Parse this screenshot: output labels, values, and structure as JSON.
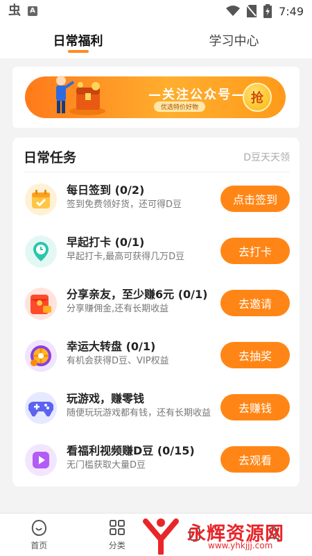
{
  "status_bar": {
    "time": "7:49",
    "app_icon": "bug-app-icon",
    "a_icon": "A"
  },
  "tabs": [
    {
      "label": "日常福利",
      "active": true
    },
    {
      "label": "学习中心",
      "active": false
    }
  ],
  "banner": {
    "title": "—关注公众号—",
    "subtitle": "优选特价好物",
    "grab_label": "抢"
  },
  "tasks_card": {
    "title": "日常任务",
    "hint": "D豆天天领",
    "tasks": [
      {
        "name": "每日签到 (0/2)",
        "desc": "签到免费领好货，还可得D豆",
        "button": "点击签到",
        "icon": "calendar-icon"
      },
      {
        "name": "早起打卡 (0/1)",
        "desc": "早起打卡,最高可获得几万D豆",
        "button": "去打卡",
        "icon": "alarm-clock-icon"
      },
      {
        "name": "分享亲友，至少赚6元 (0/1)",
        "desc": "分享赚佣金,还有长期收益",
        "button": "去邀请",
        "icon": "red-envelope-icon"
      },
      {
        "name": "幸运大转盘 (0/1)",
        "desc": "有机会获得D豆、VIP权益",
        "button": "去抽奖",
        "icon": "prize-wheel-icon"
      },
      {
        "name": "玩游戏，赚零钱",
        "desc": "随便玩玩游戏都有钱，还有长期收益",
        "button": "去赚钱",
        "icon": "gamepad-icon"
      },
      {
        "name": "看福利视频赚D豆 (0/15)",
        "desc": "无门槛获取大量D豆",
        "button": "去观看",
        "icon": "video-play-icon"
      }
    ]
  },
  "bottom_nav": [
    {
      "label": "首页",
      "icon": "home-icon"
    },
    {
      "label": "分类",
      "icon": "category-grid-icon"
    },
    {
      "label": "",
      "icon": "center-icon"
    },
    {
      "label": "",
      "icon": "profile-icon"
    }
  ],
  "watermark": {
    "text": "永辉资源网",
    "url": "www.yhkjjj.com"
  },
  "colors": {
    "accent": "#ff8616",
    "watermark": "#e8262a"
  }
}
